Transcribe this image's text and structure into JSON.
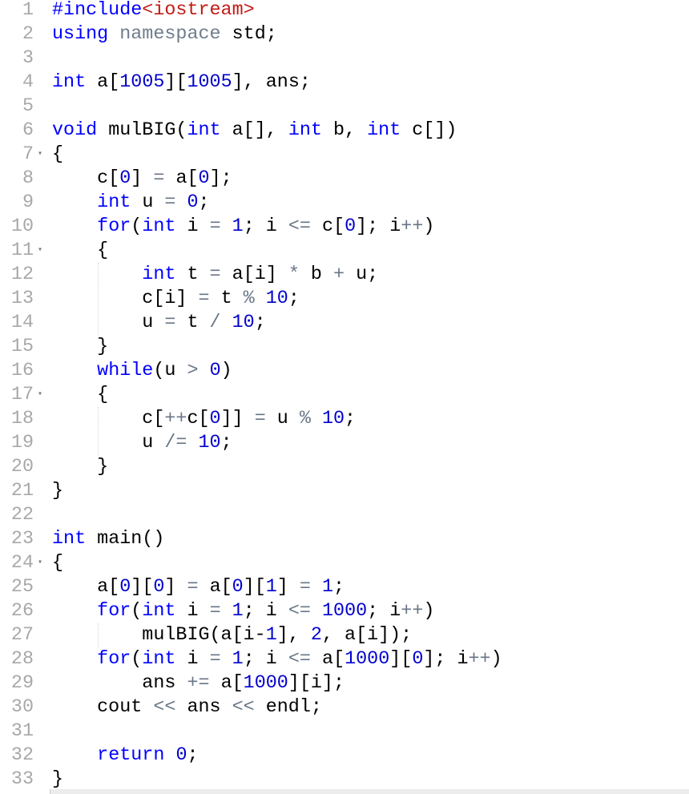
{
  "editor": {
    "fold_lines": [
      7,
      11,
      17,
      24
    ],
    "colors": {
      "keyword": "#0000ff",
      "number": "#0000cd",
      "operator": "#687687",
      "include_target": "#c41a16",
      "namespace": "#6f7d8c"
    },
    "lines": [
      [
        [
          "#include",
          "k"
        ],
        [
          "<iostream>",
          "s"
        ]
      ],
      [
        [
          "using",
          "k"
        ],
        [
          " ",
          "t"
        ],
        [
          "namespace",
          "g"
        ],
        [
          " std;",
          "t"
        ]
      ],
      [],
      [
        [
          "int",
          "k"
        ],
        [
          " a[",
          "t"
        ],
        [
          "1005",
          "n"
        ],
        [
          "][",
          "t"
        ],
        [
          "1005",
          "n"
        ],
        [
          "], ans;",
          "t"
        ]
      ],
      [],
      [
        [
          "void",
          "k"
        ],
        [
          " mulBIG(",
          "t"
        ],
        [
          "int",
          "k"
        ],
        [
          " a[], ",
          "t"
        ],
        [
          "int",
          "k"
        ],
        [
          " b, ",
          "t"
        ],
        [
          "int",
          "k"
        ],
        [
          " c[])",
          "t"
        ]
      ],
      [
        [
          "{",
          "t"
        ]
      ],
      [
        [
          "    c[",
          "t"
        ],
        [
          "0",
          "n"
        ],
        [
          "] ",
          "t"
        ],
        [
          "=",
          "o"
        ],
        [
          " a[",
          "t"
        ],
        [
          "0",
          "n"
        ],
        [
          "];",
          "t"
        ]
      ],
      [
        [
          "    ",
          "t"
        ],
        [
          "int",
          "k"
        ],
        [
          " u ",
          "t"
        ],
        [
          "=",
          "o"
        ],
        [
          " ",
          "t"
        ],
        [
          "0",
          "n"
        ],
        [
          ";",
          "t"
        ]
      ],
      [
        [
          "    ",
          "t"
        ],
        [
          "for",
          "k"
        ],
        [
          "(",
          "t"
        ],
        [
          "int",
          "k"
        ],
        [
          " i ",
          "t"
        ],
        [
          "=",
          "o"
        ],
        [
          " ",
          "t"
        ],
        [
          "1",
          "n"
        ],
        [
          "; i ",
          "t"
        ],
        [
          "<=",
          "o"
        ],
        [
          " c[",
          "t"
        ],
        [
          "0",
          "n"
        ],
        [
          "]; i",
          "t"
        ],
        [
          "++",
          "o"
        ],
        [
          ")",
          "t"
        ]
      ],
      [
        [
          "    {",
          "t"
        ]
      ],
      [
        [
          "        ",
          "t"
        ],
        [
          "int",
          "k"
        ],
        [
          " t ",
          "t"
        ],
        [
          "=",
          "o"
        ],
        [
          " a[i] ",
          "t"
        ],
        [
          "*",
          "o"
        ],
        [
          " b ",
          "t"
        ],
        [
          "+",
          "o"
        ],
        [
          " u;",
          "t"
        ]
      ],
      [
        [
          "        c[i] ",
          "t"
        ],
        [
          "=",
          "o"
        ],
        [
          " t ",
          "t"
        ],
        [
          "%",
          "o"
        ],
        [
          " ",
          "t"
        ],
        [
          "10",
          "n"
        ],
        [
          ";",
          "t"
        ]
      ],
      [
        [
          "        u ",
          "t"
        ],
        [
          "=",
          "o"
        ],
        [
          " t ",
          "t"
        ],
        [
          "/",
          "o"
        ],
        [
          " ",
          "t"
        ],
        [
          "10",
          "n"
        ],
        [
          ";",
          "t"
        ]
      ],
      [
        [
          "    }",
          "t"
        ]
      ],
      [
        [
          "    ",
          "t"
        ],
        [
          "while",
          "k"
        ],
        [
          "(u ",
          "t"
        ],
        [
          ">",
          "o"
        ],
        [
          " ",
          "t"
        ],
        [
          "0",
          "n"
        ],
        [
          ")",
          "t"
        ]
      ],
      [
        [
          "    {",
          "t"
        ]
      ],
      [
        [
          "        c[",
          "t"
        ],
        [
          "++",
          "o"
        ],
        [
          "c[",
          "t"
        ],
        [
          "0",
          "n"
        ],
        [
          "]] ",
          "t"
        ],
        [
          "=",
          "o"
        ],
        [
          " u ",
          "t"
        ],
        [
          "%",
          "o"
        ],
        [
          " ",
          "t"
        ],
        [
          "10",
          "n"
        ],
        [
          ";",
          "t"
        ]
      ],
      [
        [
          "        u ",
          "t"
        ],
        [
          "/=",
          "o"
        ],
        [
          " ",
          "t"
        ],
        [
          "10",
          "n"
        ],
        [
          ";",
          "t"
        ]
      ],
      [
        [
          "    }",
          "t"
        ]
      ],
      [
        [
          "}",
          "t"
        ]
      ],
      [],
      [
        [
          "int",
          "k"
        ],
        [
          " main()",
          "t"
        ]
      ],
      [
        [
          "{",
          "t"
        ]
      ],
      [
        [
          "    a[",
          "t"
        ],
        [
          "0",
          "n"
        ],
        [
          "][",
          "t"
        ],
        [
          "0",
          "n"
        ],
        [
          "] ",
          "t"
        ],
        [
          "=",
          "o"
        ],
        [
          " a[",
          "t"
        ],
        [
          "0",
          "n"
        ],
        [
          "][",
          "t"
        ],
        [
          "1",
          "n"
        ],
        [
          "] ",
          "t"
        ],
        [
          "=",
          "o"
        ],
        [
          " ",
          "t"
        ],
        [
          "1",
          "n"
        ],
        [
          ";",
          "t"
        ]
      ],
      [
        [
          "    ",
          "t"
        ],
        [
          "for",
          "k"
        ],
        [
          "(",
          "t"
        ],
        [
          "int",
          "k"
        ],
        [
          " i ",
          "t"
        ],
        [
          "=",
          "o"
        ],
        [
          " ",
          "t"
        ],
        [
          "1",
          "n"
        ],
        [
          "; i ",
          "t"
        ],
        [
          "<=",
          "o"
        ],
        [
          " ",
          "t"
        ],
        [
          "1000",
          "n"
        ],
        [
          "; i",
          "t"
        ],
        [
          "++",
          "o"
        ],
        [
          ")",
          "t"
        ]
      ],
      [
        [
          "        mulBIG(a[i-",
          "t"
        ],
        [
          "1",
          "n"
        ],
        [
          "], ",
          "t"
        ],
        [
          "2",
          "n"
        ],
        [
          ", a[i]);",
          "t"
        ]
      ],
      [
        [
          "    ",
          "t"
        ],
        [
          "for",
          "k"
        ],
        [
          "(",
          "t"
        ],
        [
          "int",
          "k"
        ],
        [
          " i ",
          "t"
        ],
        [
          "=",
          "o"
        ],
        [
          " ",
          "t"
        ],
        [
          "1",
          "n"
        ],
        [
          "; i ",
          "t"
        ],
        [
          "<=",
          "o"
        ],
        [
          " a[",
          "t"
        ],
        [
          "1000",
          "n"
        ],
        [
          "][",
          "t"
        ],
        [
          "0",
          "n"
        ],
        [
          "]; i",
          "t"
        ],
        [
          "++",
          "o"
        ],
        [
          ")",
          "t"
        ]
      ],
      [
        [
          "        ans ",
          "t"
        ],
        [
          "+=",
          "o"
        ],
        [
          " a[",
          "t"
        ],
        [
          "1000",
          "n"
        ],
        [
          "][i];",
          "t"
        ]
      ],
      [
        [
          "    cout ",
          "t"
        ],
        [
          "<<",
          "o"
        ],
        [
          " ans ",
          "t"
        ],
        [
          "<<",
          "o"
        ],
        [
          " endl;",
          "t"
        ]
      ],
      [],
      [
        [
          "    ",
          "t"
        ],
        [
          "return",
          "k"
        ],
        [
          " ",
          "t"
        ],
        [
          "0",
          "n"
        ],
        [
          ";",
          "t"
        ]
      ],
      [
        [
          "}",
          "t"
        ]
      ]
    ]
  }
}
